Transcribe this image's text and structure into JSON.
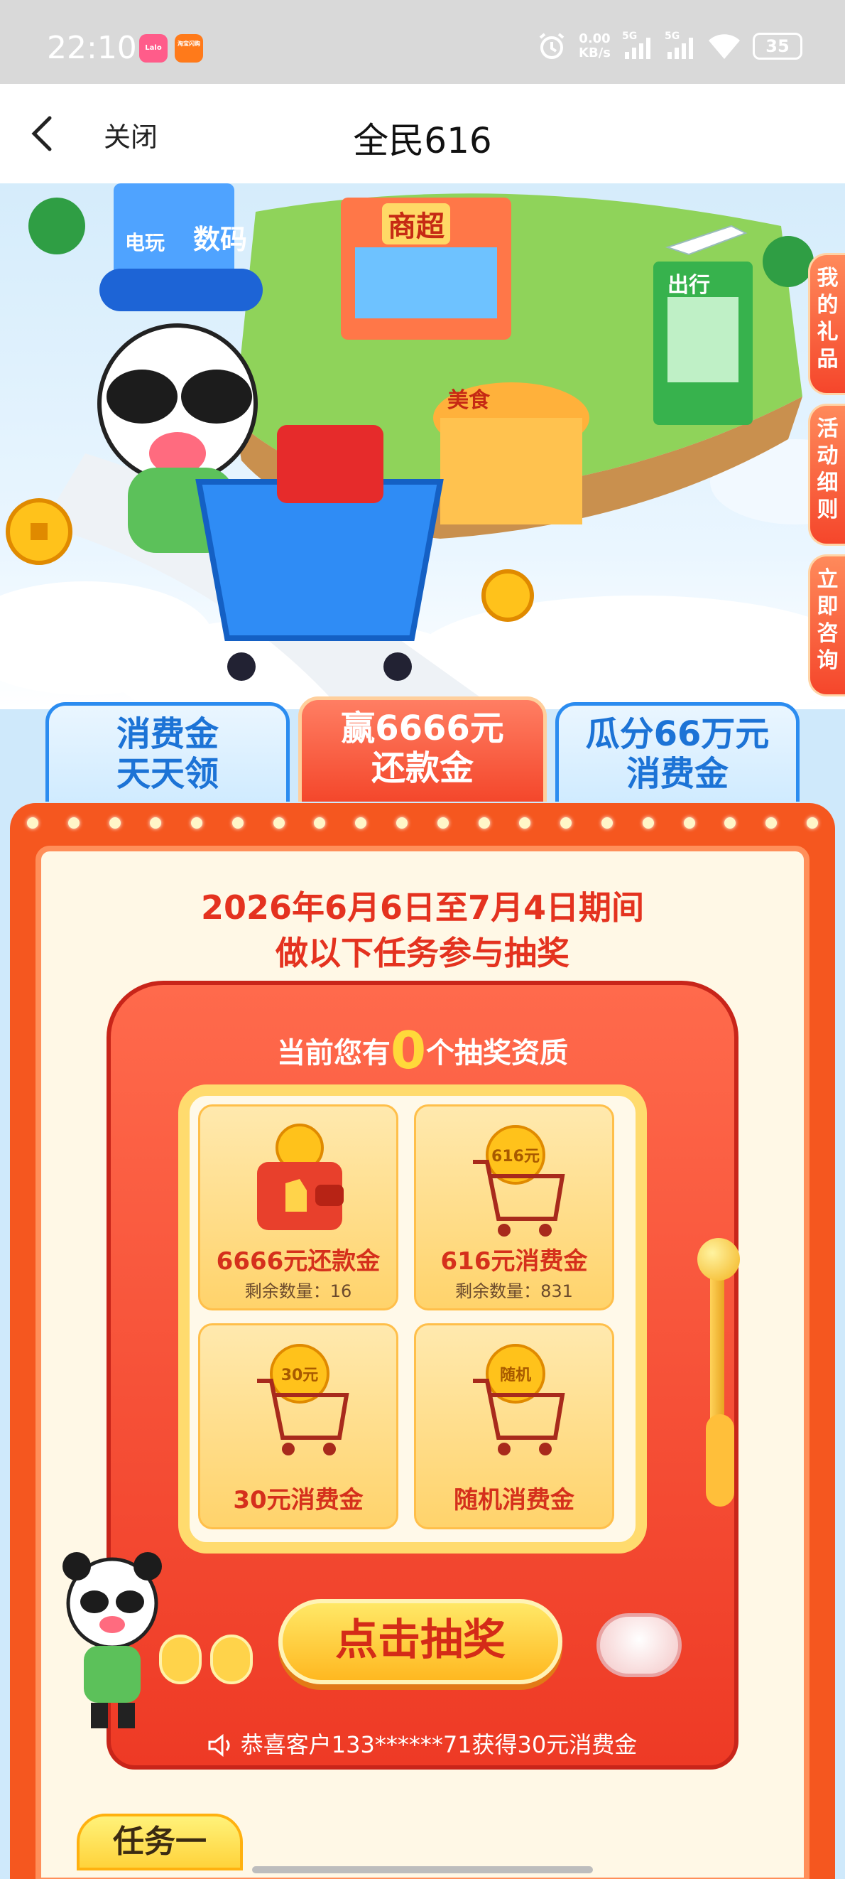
{
  "status_bar": {
    "time": "22:10",
    "app1": "Lalo",
    "app2": "淘宝闪购",
    "net_speed_value": "0.00",
    "net_speed_unit": "KB/s",
    "signal1": "5G",
    "signal2": "5G",
    "battery": "35"
  },
  "nav": {
    "close_label": "关闭",
    "title": "全民616"
  },
  "hero": {
    "sign_shuma": "数码",
    "sign_dianwan": "电玩",
    "sign_shangchao": "商超",
    "sign_meishi": "美食",
    "sign_chuxing": "出行",
    "side_tabs": [
      "我的礼品",
      "活动细则",
      "立即咨询"
    ]
  },
  "tabs": [
    {
      "line1": "消费金",
      "line2": "天天领"
    },
    {
      "line1": "赢6666元",
      "line2": "还款金"
    },
    {
      "line1": "瓜分66万元",
      "line2": "消费金"
    }
  ],
  "main": {
    "period_line1": "2026年6月6日至7月4日期间",
    "period_line2": "做以下任务参与抽奖",
    "qual_prefix": "当前您有",
    "qual_count": "0",
    "qual_suffix": "个抽奖资质",
    "prizes": [
      {
        "name": "6666元还款金",
        "remaining": "剩余数量：16",
        "icon": "wallet-icon"
      },
      {
        "name": "616元消费金",
        "remaining": "剩余数量：831",
        "icon": "cart-coin-icon",
        "coin_label": "616元"
      },
      {
        "name": "30元消费金",
        "icon": "cart-coin-icon",
        "coin_label": "30元"
      },
      {
        "name": "随机消费金",
        "icon": "cart-coin-icon",
        "coin_label": "随机"
      }
    ],
    "draw_button": "点击抽奖",
    "notice": "恭喜客户133******71获得30元消费金",
    "task_tag": "任务一"
  },
  "colors": {
    "accent_red": "#f4472b",
    "gold": "#ffd93a",
    "tab_blue": "#1c73d6"
  }
}
